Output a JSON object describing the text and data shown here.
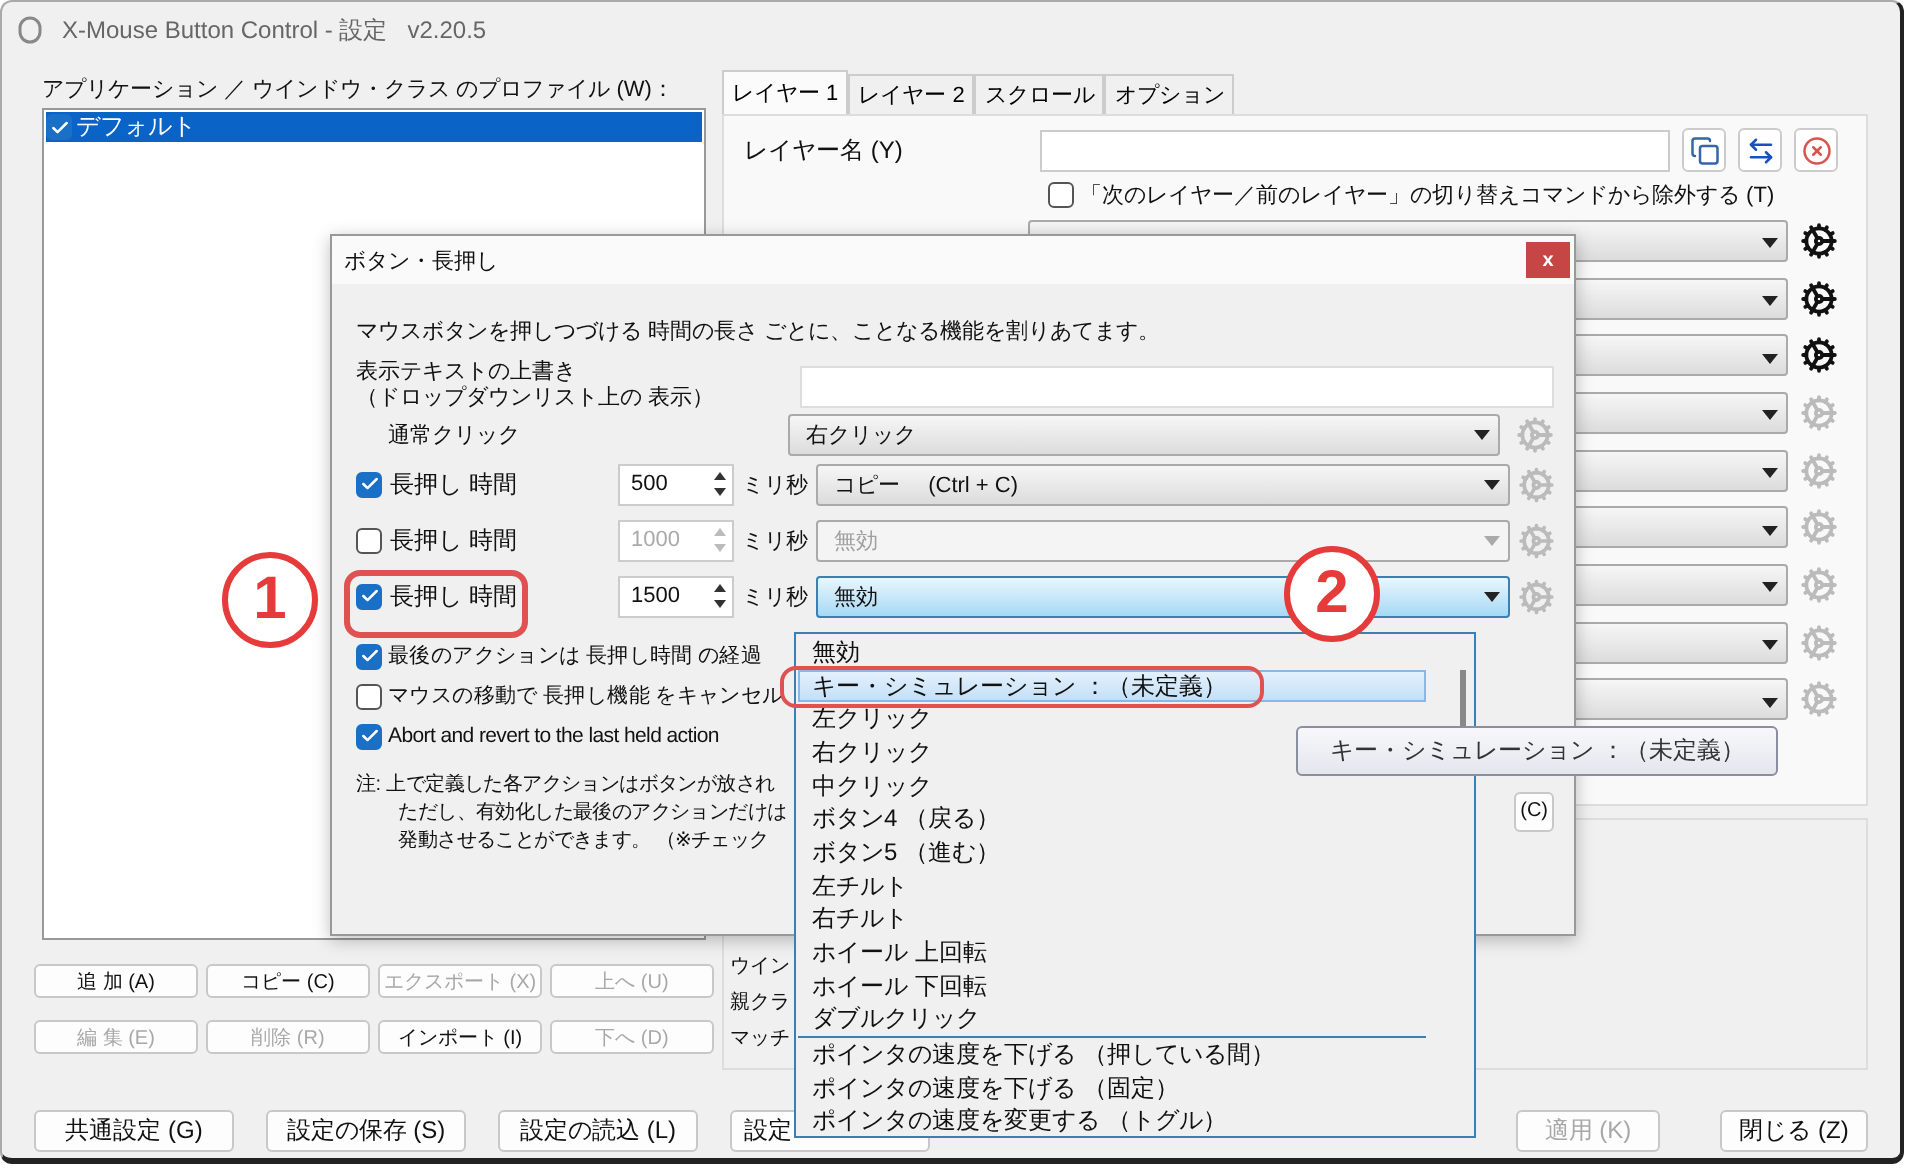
{
  "window": {
    "title": "X-Mouse Button Control - 設定",
    "version": "v2.20.5"
  },
  "profiles": {
    "label": "アプリケーション ／ ウインドウ・クラス のプロファイル (W)：",
    "items": [
      {
        "label": "デフォルト",
        "checked": true,
        "selected": true
      }
    ]
  },
  "profile_buttons": [
    {
      "label": "追 加 (A)",
      "disabled": false
    },
    {
      "label": "コピー (C)",
      "disabled": false
    },
    {
      "label": "エクスポート (X)",
      "disabled": true
    },
    {
      "label": "上へ (U)",
      "disabled": true
    },
    {
      "label": "編 集 (E)",
      "disabled": true
    },
    {
      "label": "削除 (R)",
      "disabled": true
    },
    {
      "label": "インポート (I)",
      "disabled": false
    },
    {
      "label": "下へ (D)",
      "disabled": true
    }
  ],
  "tabs": [
    {
      "label": "レイヤー 1",
      "selected": true
    },
    {
      "label": "レイヤー 2",
      "selected": false
    },
    {
      "label": "スクロール",
      "selected": false
    },
    {
      "label": "オプション",
      "selected": false
    }
  ],
  "layer": {
    "name_label": "レイヤー名 (Y)",
    "exclude": {
      "label": "「次のレイヤー／前のレイヤー」の切り替えコマンドから除外する (T)",
      "checked": false
    }
  },
  "button_rows": [
    {
      "gear_enabled": true
    },
    {
      "gear_enabled": true
    },
    {
      "gear_enabled": true
    },
    {
      "gear_enabled": false
    },
    {
      "gear_enabled": false
    },
    {
      "gear_enabled": false
    },
    {
      "gear_enabled": false
    },
    {
      "gear_enabled": false
    },
    {
      "gear_enabled": false
    }
  ],
  "lower_panel": {
    "labels": [
      "ウイン",
      "親クラ",
      "マッチ"
    ]
  },
  "footer_buttons": [
    {
      "label": "共通設定 (G)",
      "disabled": false
    },
    {
      "label": "設定の保存 (S)",
      "disabled": false
    },
    {
      "label": "設定の読込 (L)",
      "disabled": false
    },
    {
      "label": "設定",
      "disabled": false
    }
  ],
  "footer_right_buttons": [
    {
      "label": "適用 (K)",
      "disabled": true
    },
    {
      "label": "閉じる (Z)",
      "disabled": false
    }
  ],
  "dialog": {
    "title": "ボタン・長押し",
    "close": "x",
    "description": "マウスボタンを押しつづける 時間の長さ ごとに、ことなる機能を割りあてます。",
    "override_label": [
      "表示テキストの上書き",
      "（ドロップダウンリスト上の 表示）"
    ],
    "normal_click": {
      "label": "通常クリック",
      "value": "右クリック"
    },
    "long_press": [
      {
        "label": "長押し 時間",
        "checked": true,
        "ms": "500",
        "unit": "ミリ秒",
        "value": "コピー　 (Ctrl + C)",
        "focused": false
      },
      {
        "label": "長押し 時間",
        "checked": false,
        "ms": "1000",
        "unit": "ミリ秒",
        "value": "無効",
        "focused": false
      },
      {
        "label": "長押し 時間",
        "checked": true,
        "ms": "1500",
        "unit": "ミリ秒",
        "value": "無効",
        "focused": true
      }
    ],
    "options": [
      {
        "label": "最後のアクションは 長押し時間 の経過",
        "checked": true
      },
      {
        "label": "マウスの移動で 長押し機能 をキャンセル",
        "checked": false
      },
      {
        "label": "Abort and revert to the last held action",
        "checked": true
      }
    ],
    "note_mark": "注:",
    "note_lines": [
      "上で定義した各アクションはボタンが放され",
      "ただし、有効化した最後のアクションだけは",
      "発動させることができます。 （※チェック"
    ],
    "button": "(C)"
  },
  "dropdown": {
    "groups": [
      [
        {
          "label": "無効",
          "selected": false
        },
        {
          "label": "キー・シミュレーション ：（未定義）",
          "selected": true
        },
        {
          "label": "左クリック",
          "selected": false
        },
        {
          "label": "右クリック",
          "selected": false
        },
        {
          "label": "中クリック",
          "selected": false
        },
        {
          "label": "ボタン4 （戻る）",
          "selected": false
        },
        {
          "label": "ボタン5 （進む）",
          "selected": false
        },
        {
          "label": "左チルト",
          "selected": false
        },
        {
          "label": "右チルト",
          "selected": false
        },
        {
          "label": "ホイール 上回転",
          "selected": false
        },
        {
          "label": "ホイール 下回転",
          "selected": false
        },
        {
          "label": "ダブルクリック",
          "selected": false
        }
      ],
      [
        {
          "label": "ポインタの速度を下げる （押している間）",
          "selected": false
        },
        {
          "label": "ポインタの速度を下げる （固定）",
          "selected": false
        },
        {
          "label": "ポインタの速度を変更する （トグル）",
          "selected": false
        }
      ]
    ]
  },
  "tooltip": {
    "text": "キー・シミュレーション ：（未定義）"
  },
  "annotations": [
    {
      "label": "1"
    },
    {
      "label": "2"
    }
  ]
}
